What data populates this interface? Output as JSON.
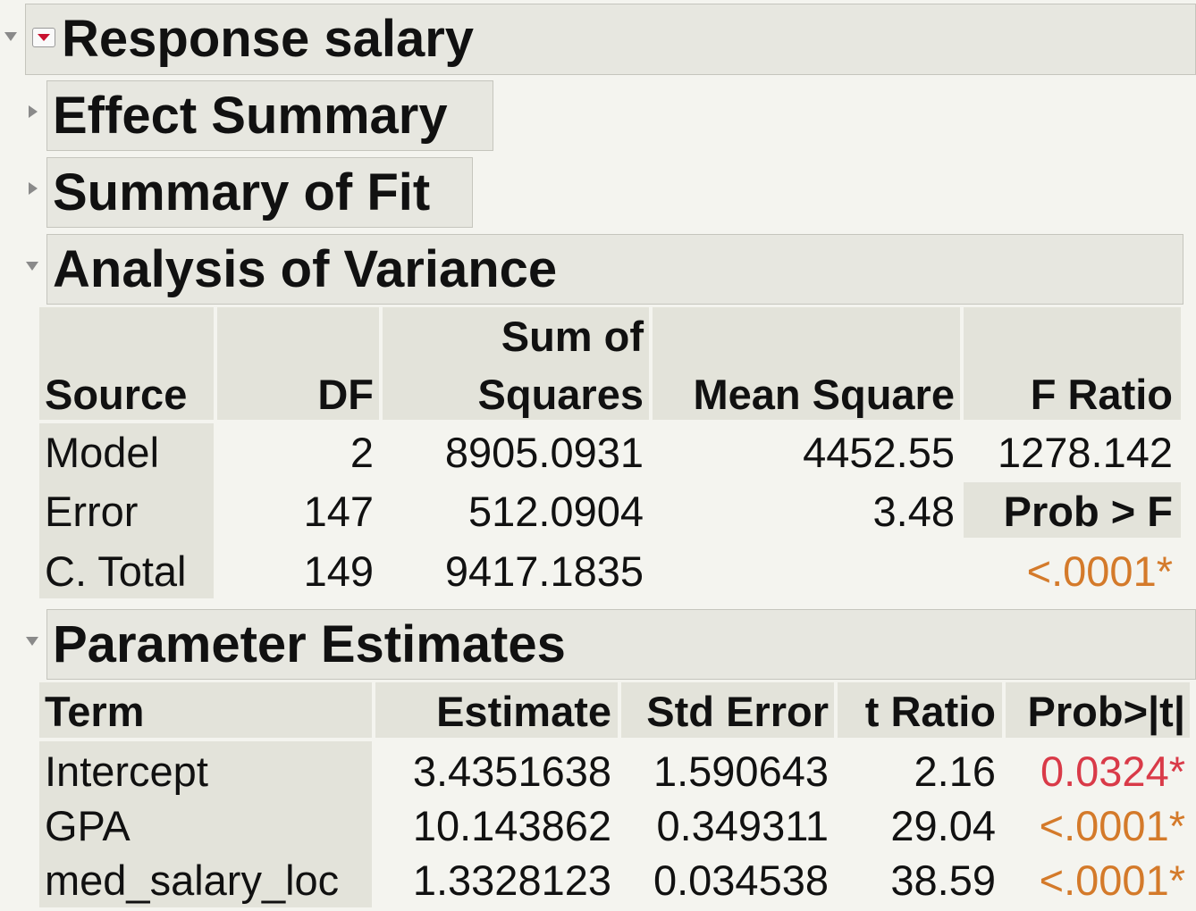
{
  "response": {
    "title": "Response salary"
  },
  "sections": {
    "effect_summary": "Effect Summary",
    "summary_of_fit": "Summary of Fit",
    "anova": "Analysis of Variance",
    "param": "Parameter Estimates"
  },
  "anova": {
    "headers": {
      "source": "Source",
      "df": "DF",
      "ss_line1": "Sum of",
      "ss_line2": "Squares",
      "ms": "Mean Square",
      "f": "F Ratio"
    },
    "rows": [
      {
        "source": "Model",
        "df": "2",
        "ss": "8905.0931",
        "ms": "4452.55"
      },
      {
        "source": "Error",
        "df": "147",
        "ss": "512.0904",
        "ms": "3.48"
      },
      {
        "source": "C. Total",
        "df": "149",
        "ss": "9417.1835",
        "ms": ""
      }
    ],
    "f_ratio": "1278.142",
    "prob_label": "Prob > F",
    "prob_value": "<.0001*"
  },
  "params": {
    "headers": {
      "term": "Term",
      "estimate": "Estimate",
      "stderr": "Std Error",
      "tratio": "t Ratio",
      "prob": "Prob>|t|"
    },
    "rows": [
      {
        "term": "Intercept",
        "estimate": "3.4351638",
        "stderr": "1.590643",
        "tratio": "2.16",
        "prob": "0.0324*"
      },
      {
        "term": "GPA",
        "estimate": "10.143862",
        "stderr": "0.349311",
        "tratio": "29.04",
        "prob": "<.0001*"
      },
      {
        "term": "med_salary_loc",
        "estimate": "1.3328123",
        "stderr": "0.034538",
        "tratio": "38.59",
        "prob": "<.0001*"
      }
    ]
  },
  "colors": {
    "significant_red": "#d93a48",
    "significant_orange": "#d47a2a",
    "header_bg": "#e3e3da"
  },
  "icons": [
    "disclosure-down-icon",
    "disclosure-right-icon",
    "red-menu-icon"
  ]
}
